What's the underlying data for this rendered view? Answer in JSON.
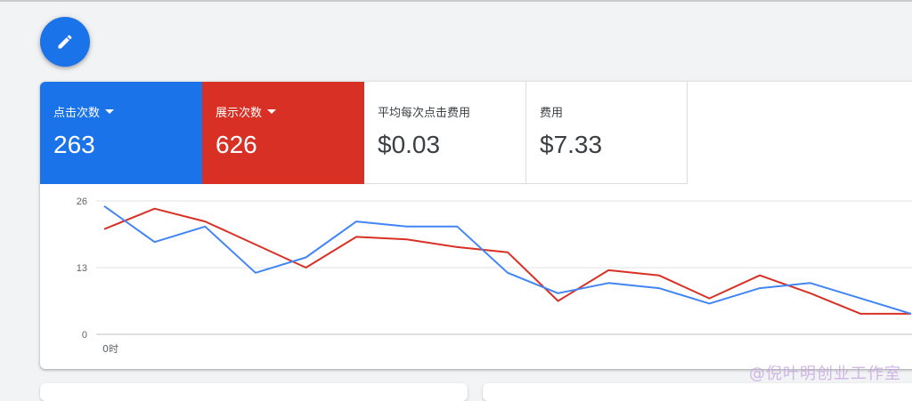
{
  "metrics": [
    {
      "label": "点击次数",
      "value": "263",
      "style": "blue",
      "dropdown": true
    },
    {
      "label": "展示次数",
      "value": "626",
      "style": "red",
      "dropdown": true
    },
    {
      "label": "平均每次点击费用",
      "value": "$0.03",
      "style": "plain",
      "dropdown": false
    },
    {
      "label": "费用",
      "value": "$7.33",
      "style": "plain",
      "dropdown": false
    }
  ],
  "fab": {
    "icon": "pencil-icon"
  },
  "watermark": "@倪叶明创业工作室",
  "colors": {
    "blue": "#1a73e8",
    "red": "#d93025",
    "background": "#f1f3f4",
    "clicks_line": "#4285f4",
    "impressions_line": "#d93025"
  },
  "chart_data": {
    "type": "line",
    "y_ticks": [
      "26",
      "13",
      "0"
    ],
    "x_tick_label": "0时",
    "ylim": [
      0,
      26
    ],
    "x": [
      0,
      1,
      2,
      3,
      4,
      5,
      6,
      7,
      8,
      9,
      10,
      11,
      12,
      13,
      14,
      15,
      16
    ],
    "series": [
      {
        "name": "点击次数",
        "color": "#4285f4",
        "values": [
          25,
          18,
          21,
          12,
          15,
          22,
          21,
          21,
          12,
          8,
          10,
          9,
          6,
          9,
          10,
          7,
          4
        ]
      },
      {
        "name": "展示次数",
        "color": "#d93025",
        "values": [
          20.5,
          24.5,
          22,
          17.5,
          13,
          19,
          18.5,
          17,
          16,
          6.5,
          12.5,
          11.5,
          7,
          11.5,
          8,
          4,
          4
        ]
      }
    ],
    "grid": true
  }
}
